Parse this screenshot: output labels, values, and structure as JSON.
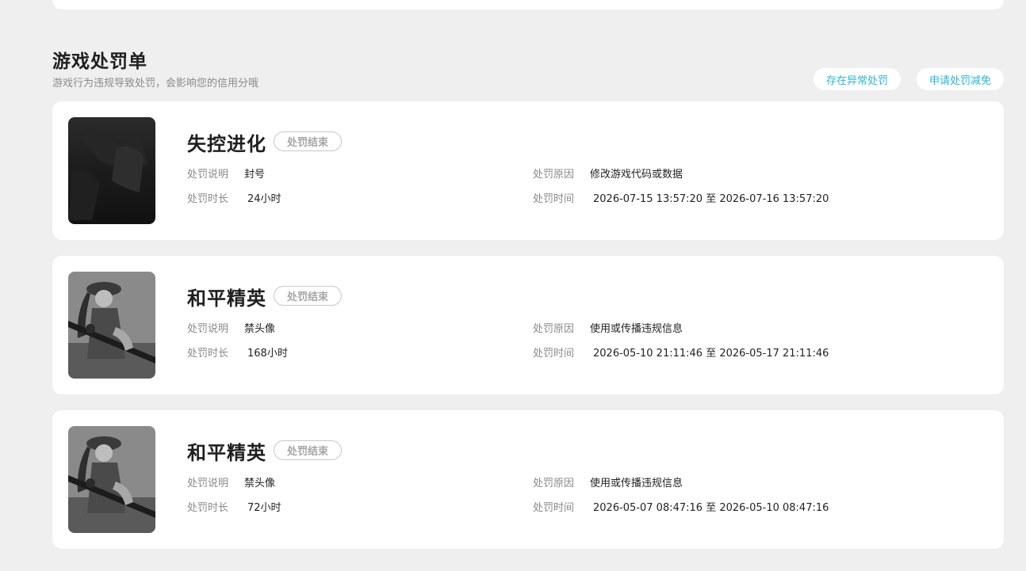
{
  "section": {
    "title": "游戏处罚单",
    "subtitle": "游戏行为违规导致处罚，会影响您的信用分哦",
    "actions": {
      "abnormal_label": "存在异常处罚",
      "reduce_label": "申请处罚减免"
    }
  },
  "colors": {
    "accent": "#29b6d8",
    "background": "#efefef",
    "card": "#ffffff"
  },
  "labels": {
    "description": "处罚说明",
    "duration": "处罚时长",
    "reason": "处罚原因",
    "time": "处罚时间"
  },
  "penalties": [
    {
      "game": "失控进化",
      "status": "处罚结束",
      "description": "封号",
      "duration": "24小时",
      "reason": "修改游戏代码或数据",
      "time": "2026-07-15 13:57:20 至 2026-07-16 13:57:20"
    },
    {
      "game": "和平精英",
      "status": "处罚结束",
      "description": "禁头像",
      "duration": "168小时",
      "reason": "使用或传播违规信息",
      "time": "2026-05-10 21:11:46 至 2026-05-17 21:11:46"
    },
    {
      "game": "和平精英",
      "status": "处罚结束",
      "description": "禁头像",
      "duration": "72小时",
      "reason": "使用或传播违规信息",
      "time": "2026-05-07 08:47:16 至 2026-05-10 08:47:16"
    }
  ]
}
